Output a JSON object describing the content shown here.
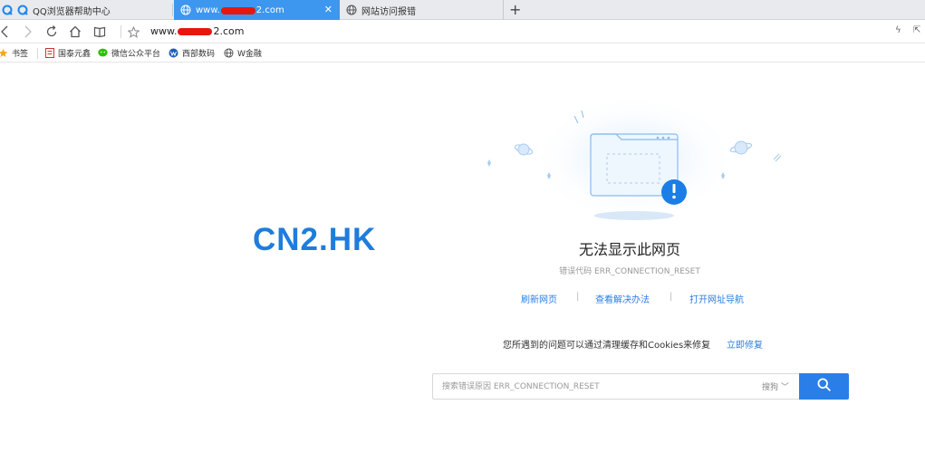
{
  "tabs": [
    {
      "label": "QQ浏览器帮助中心",
      "icon": "qq-browser-icon"
    },
    {
      "label_prefix": "www.",
      "label_suffix": "2.com",
      "icon": "globe-icon",
      "active": true
    },
    {
      "label": "网站访问报错",
      "icon": "globe-icon"
    }
  ],
  "address_bar": {
    "url_prefix": "www.",
    "url_suffix": "2.com"
  },
  "bookmarks": {
    "bookmarks_label": "书签",
    "items": [
      {
        "label": "国泰元鑫"
      },
      {
        "label": "微信公众平台"
      },
      {
        "label": "西部数码"
      },
      {
        "label": "W金融"
      }
    ]
  },
  "brand_text": "CN2.HK",
  "error": {
    "title": "无法显示此网页",
    "code_label": "错误代码 ERR_CONNECTION_RESET"
  },
  "actions": {
    "refresh": "刷新网页",
    "solutions": "查看解决办法",
    "nav": "打开网址导航",
    "separator": "|"
  },
  "cache": {
    "text": "您所遇到的问题可以通过清理缓存和Cookies来修复",
    "link": "立即修复"
  },
  "search": {
    "placeholder": "搜索错误原因 ERR_CONNECTION_RESET",
    "engine": "搜狗 ﹀"
  },
  "colors": {
    "accent": "#2a7ee8",
    "active_tab": "#3d97ee",
    "brand": "#1e7ddc",
    "alert": "#1a7ee6"
  }
}
